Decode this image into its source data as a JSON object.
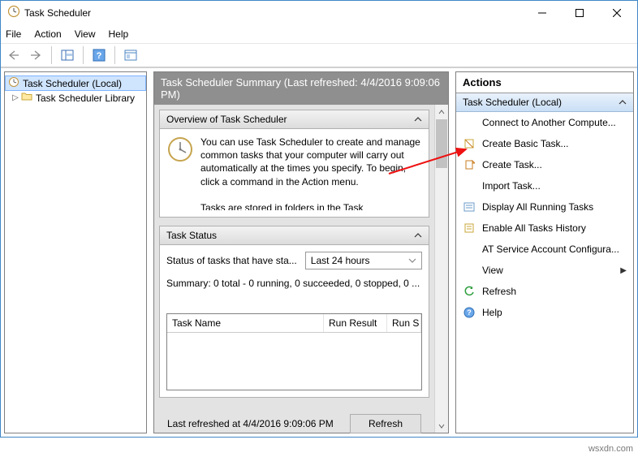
{
  "window": {
    "title": "Task Scheduler"
  },
  "menu": {
    "file": "File",
    "action": "Action",
    "view": "View",
    "help": "Help"
  },
  "tree": {
    "root": "Task Scheduler (Local)",
    "child": "Task Scheduler Library"
  },
  "center": {
    "header": "Task Scheduler Summary (Last refreshed: 4/4/2016 9:09:06 PM)",
    "overview_title": "Overview of Task Scheduler",
    "overview_text1": "You can use Task Scheduler to create and manage common tasks that your computer will carry out automatically at the times you specify. To begin, click a command in the Action menu.",
    "overview_text2": "Tasks are stored in folders in the Task",
    "status_title": "Task Status",
    "status_label": "Status of tasks that have sta...",
    "status_range": "Last 24 hours",
    "summary": "Summary: 0 total - 0 running, 0 succeeded, 0 stopped, 0 ...",
    "col_task": "Task Name",
    "col_result": "Run Result",
    "col_start": "Run S",
    "footer_text": "Last refreshed at 4/4/2016 9:09:06 PM",
    "refresh_btn": "Refresh"
  },
  "actions": {
    "title": "Actions",
    "section": "Task Scheduler (Local)",
    "items": [
      "Connect to Another Compute...",
      "Create Basic Task...",
      "Create Task...",
      "Import Task...",
      "Display All Running Tasks",
      "Enable All Tasks History",
      "AT Service Account Configura...",
      "View",
      "Refresh",
      "Help"
    ]
  },
  "watermark": "wsxdn.com"
}
